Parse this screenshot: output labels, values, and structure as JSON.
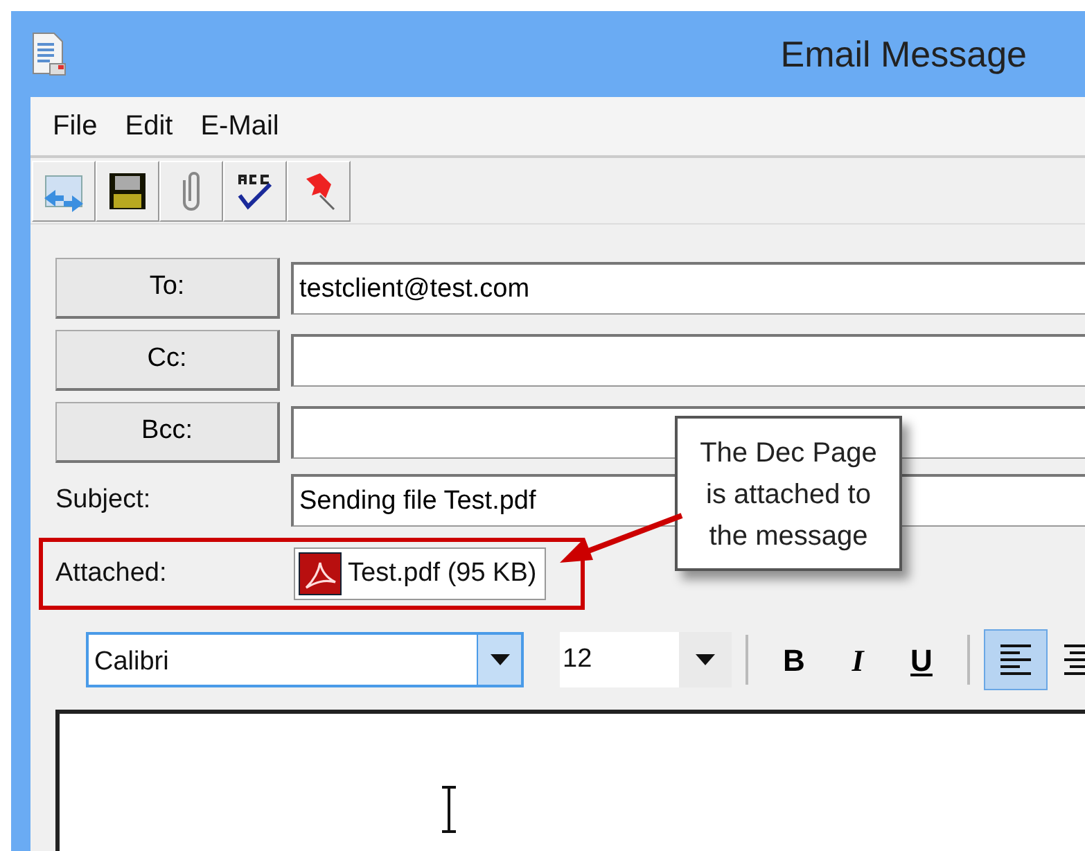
{
  "window": {
    "title": "Email Message"
  },
  "menu": [
    "File",
    "Edit",
    "E-Mail"
  ],
  "recipients": [
    {
      "label": "To:",
      "value": "testclient@test.com"
    },
    {
      "label": "Cc:"
    },
    {
      "label": "Bcc:"
    }
  ],
  "subject": {
    "label": "Subject:",
    "value": "Sending file Test.pdf"
  },
  "attached": {
    "label": "Attached:",
    "file": "Test.pdf (95 KB)"
  },
  "format_bar": {
    "font": "Calibri",
    "size": "12",
    "buttons": [
      {
        "kind": "bold",
        "label": "B",
        "selected": false
      },
      {
        "kind": "italic",
        "label": "I",
        "selected": false
      },
      {
        "kind": "underline",
        "label": "U",
        "selected": false
      },
      {
        "kind": "align-left",
        "selected": true
      },
      {
        "kind": "align-center",
        "selected": false
      }
    ]
  },
  "callout": {
    "text": "The Dec Page is attached to the message"
  }
}
